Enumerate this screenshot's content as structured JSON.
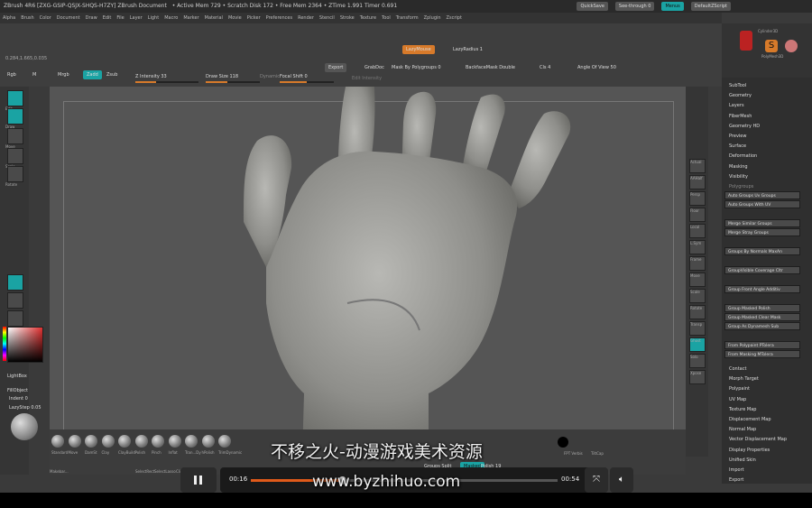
{
  "app": {
    "title_bar": {
      "title": "ZBrush 4R6 [ZXG-GSIP-QSJX-SHQS-H7ZY]   ZBrush Document",
      "stats": "• Active Mem 729 • Scratch Disk 172 • Free Mem 2364 • ZTime 1.991 Timer 0.691",
      "quicksave": "QuickSave",
      "see_through": "See-through  0",
      "menus_label": "Menus",
      "default_zscript": "DefaultZScript"
    },
    "menubar": [
      "Alpha",
      "Brush",
      "Color",
      "Document",
      "Draw",
      "Edit",
      "File",
      "Layer",
      "Light",
      "Macro",
      "Marker",
      "Material",
      "Movie",
      "Picker",
      "Preferences",
      "Render",
      "Stencil",
      "Stroke",
      "Texture",
      "Tool",
      "Transform",
      "Zplugin",
      "Zscript"
    ],
    "top_shelf": {
      "lazymouse": "LazyMouse",
      "lazyradius": "LazyRadius 1",
      "coords": "0.284,1.665,0.035",
      "rgb": "Rgb",
      "m": "M",
      "mrgb": "Mrgb",
      "zadd": "Zadd",
      "zsub": "Zsub",
      "z_intensity": "Z Intensity 33",
      "draw_size": "Draw Size 118",
      "dynamic": "Dynamic",
      "focal_shift": "Focal Shift 0",
      "export": "Export",
      "grabdoc": "GrabDoc",
      "mask_by_polygroups": "Mask By Polygroups 0",
      "backface_double": "BackfaceMask  Double",
      "cls": "Cls 4",
      "angle_of_view": "Angle Of View 50",
      "edit_intensity": "Edit Intensity"
    },
    "left_tools": [
      "Edit",
      "Draw",
      "Move",
      "Scale",
      "Rotate"
    ],
    "left_labels": {
      "lightbox": "LightBox",
      "fillobject": "FillObject",
      "indent": "Indent 0",
      "lazystep": "LazyStep 0.05"
    },
    "right_shelf": [
      "Actual",
      "AAHalf",
      "Persp",
      "Floor",
      "Local",
      "L.Sym",
      "Frame",
      "Move",
      "Scale",
      "Rotate",
      "Transp",
      "Ghost",
      "Solo",
      "Xpose"
    ],
    "right_panel": {
      "tool_thumbs": [
        "Cylinder3D",
        "PolyMesh3D",
        "SimpleBr..."
      ],
      "subpalettes": [
        "SubTool",
        "Geometry",
        "Layers",
        "FiberMesh",
        "Geometry HD",
        "Preview",
        "Surface",
        "Deformation",
        "Masking",
        "Visibility"
      ],
      "polygroups_header": "Polygroups",
      "polygroup_buttons": [
        "Auto Groups   Uv Groups",
        "Auto Groups With UV",
        "Merge Similar Groups",
        "Merge Stray Groups",
        "Groups By Normals   MaxAn",
        "GroupVisible   Coverage Cltr",
        "Group Front   Angle   Additiv",
        "Group Masked   Polish",
        "Group Masked Clear Mask",
        "Group As Dynamesh Sub",
        "From Polypaint   PTolera",
        "From Masking   MTolera"
      ],
      "more_subpalettes": [
        "Contact",
        "Morph Target",
        "Polypaint",
        "UV Map",
        "Texture Map",
        "Displacement Map",
        "Normal Map",
        "Vector Displacement Map",
        "Display Properties",
        "Unified Skin",
        "Import",
        "Export"
      ]
    },
    "bottom_shelf": {
      "brushes": [
        "Standard",
        "Move",
        "DamSt",
        "Clay",
        "ClayBuild",
        "Polish",
        "Pinch",
        "Inflat",
        "Tran...Dy",
        "hPolish",
        "TrimDynamic"
      ],
      "extra": [
        "Makebar...",
        "SelectRect",
        "SelectLasso",
        "ClipCurve"
      ],
      "groups_split": "Groups Split",
      "masked": "Masked",
      "polish": "Polish 19",
      "fill": "FPT Verbis",
      "tilt": "TiltCap"
    }
  },
  "video": {
    "current_time": "00:16",
    "duration": "00:54",
    "progress": 0.296
  },
  "watermark": {
    "line1": "不移之火-动漫游戏美术资源",
    "line2": "www.byzhihuo.com"
  }
}
